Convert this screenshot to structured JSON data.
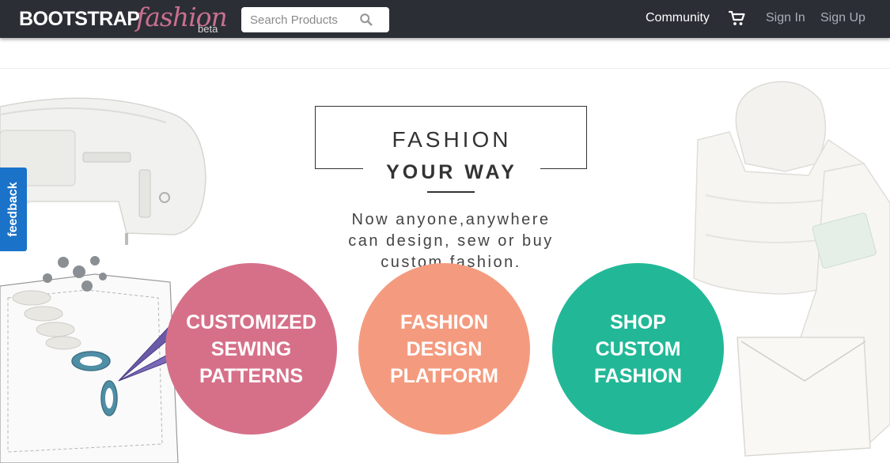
{
  "navbar": {
    "logo_main": "BOOTSTRAP",
    "logo_script": "fashion",
    "logo_beta": "beta",
    "search_placeholder": "Search Products",
    "community_label": "Community",
    "signin_label": "Sign In",
    "signup_label": "Sign Up",
    "bg_color": "#2b2e35",
    "icons": {
      "search": "search-icon",
      "cart": "cart-icon"
    }
  },
  "hero": {
    "title_line1": "FASHION",
    "title_line2": "YOUR WAY",
    "subtitle_lines": [
      "Now anyone,anywhere",
      "can design, sew or buy",
      "custom fashion."
    ],
    "circles": [
      {
        "lines": [
          "CUSTOMIZED",
          "SEWING",
          "PATTERNS"
        ],
        "color": "#d67089"
      },
      {
        "lines": [
          "FASHION",
          "DESIGN",
          "PLATFORM"
        ],
        "color": "#f49b7f"
      },
      {
        "lines": [
          "SHOP",
          "CUSTOM",
          "FASHION"
        ],
        "color": "#22b897"
      }
    ]
  },
  "feedback": {
    "label": "feedback",
    "color": "#1a73c9"
  }
}
